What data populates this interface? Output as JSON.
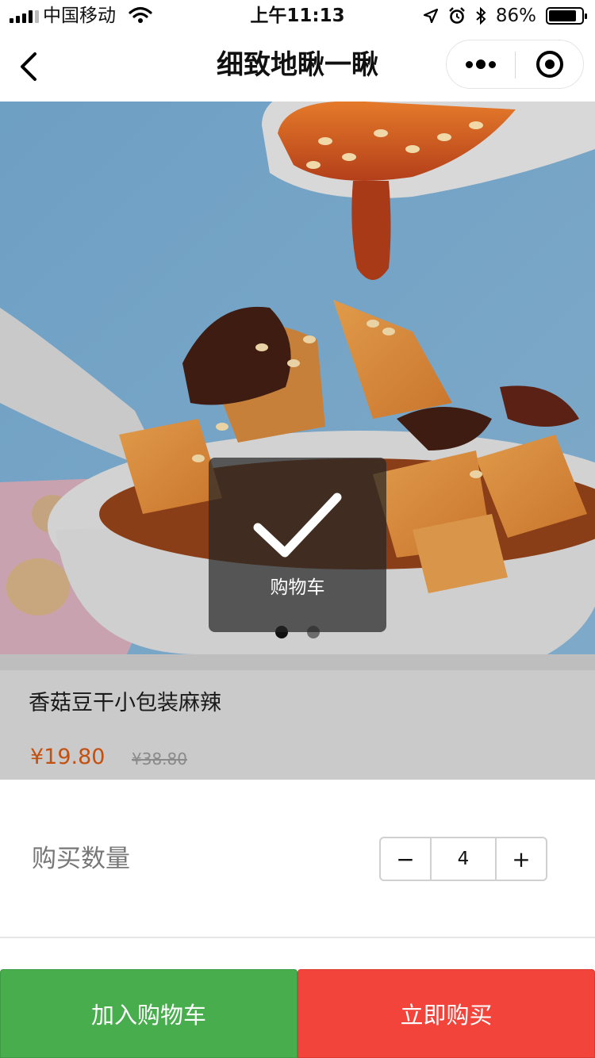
{
  "status_bar": {
    "carrier": "中国移动",
    "time": "上午11:13",
    "battery_percent": "86%",
    "battery_level": 0.86
  },
  "nav": {
    "title": "细致地瞅一瞅"
  },
  "carousel": {
    "slide_count": 2,
    "active_index": 0
  },
  "toast": {
    "text": "购物车",
    "icon": "checkmark-icon"
  },
  "product": {
    "name": "香菇豆干小包装麻辣",
    "price": "¥19.80",
    "original_price": "¥38.80"
  },
  "quantity": {
    "label": "购买数量",
    "minus": "−",
    "value": "4",
    "plus": "+"
  },
  "actions": {
    "add_to_cart": "加入购物车",
    "buy_now": "立即购买"
  },
  "colors": {
    "add_to_cart": "#47ad4d",
    "buy_now": "#f2443b",
    "price": "#c4500f"
  }
}
